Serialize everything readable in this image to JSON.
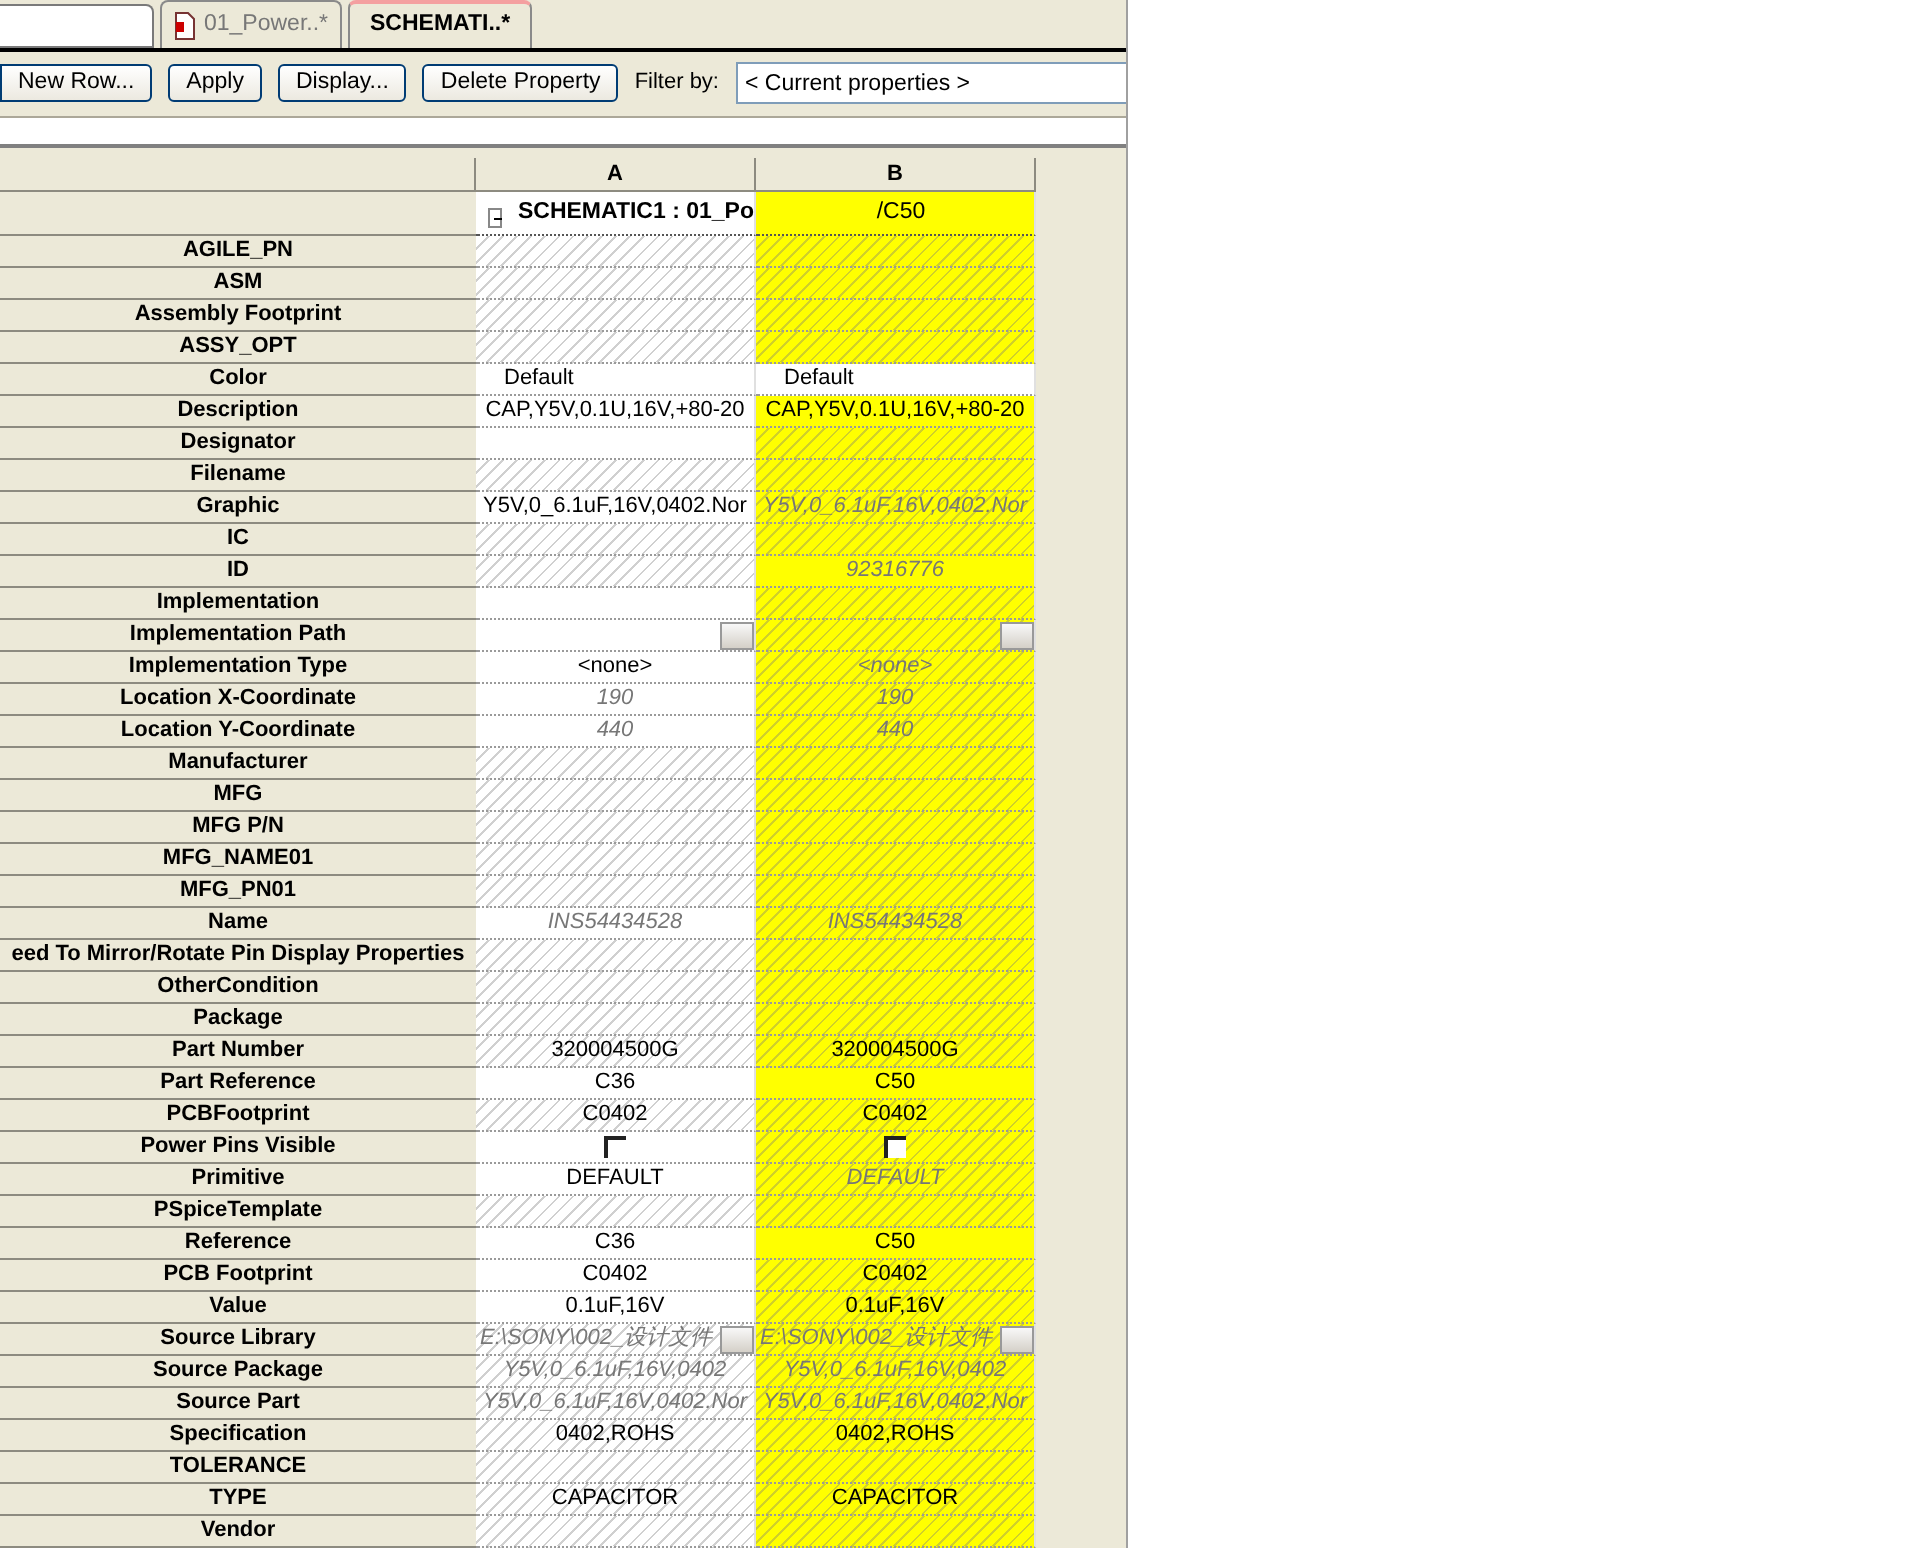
{
  "tabs": [
    {
      "label": "01_Power..*",
      "selected": false,
      "kind": "document"
    },
    {
      "label": "SCHEMATI..*",
      "selected": true,
      "kind": "plain"
    }
  ],
  "toolbar": {
    "buttons": [
      "New Row...",
      "Apply",
      "Display...",
      "Delete Property"
    ],
    "filter_label": "Filter by:",
    "filter_value": "< Current properties >"
  },
  "columns": [
    {
      "label": "A",
      "selected": false
    },
    {
      "label": "B",
      "selected": true
    }
  ],
  "group": {
    "expanded": true,
    "cells": [
      "SCHEMATIC1 : 01_Po",
      "/C50"
    ]
  },
  "rows": [
    {
      "name": "AGILE_PN",
      "cells": [
        {
          "hatched": true
        },
        {
          "hatched": true
        }
      ]
    },
    {
      "name": "ASM",
      "cells": [
        {
          "hatched": true
        },
        {
          "hatched": true
        }
      ]
    },
    {
      "name": "Assembly Footprint",
      "cells": [
        {
          "hatched": true
        },
        {
          "hatched": true
        }
      ]
    },
    {
      "name": "ASSY_OPT",
      "cells": [
        {
          "hatched": true
        },
        {
          "hatched": true
        }
      ]
    },
    {
      "name": "Color",
      "cells": [
        {
          "kind": "dropdown",
          "value": "Default"
        },
        {
          "kind": "dropdown",
          "value": "Default"
        }
      ]
    },
    {
      "name": "Description",
      "cells": [
        {
          "value": "CAP,Y5V,0.1U,16V,+80-20"
        },
        {
          "value": "CAP,Y5V,0.1U,16V,+80-20"
        }
      ]
    },
    {
      "name": "Designator",
      "cells": [
        {},
        {
          "hatched": true
        }
      ]
    },
    {
      "name": "Filename",
      "cells": [
        {
          "hatched": true
        },
        {
          "hatched": true
        }
      ]
    },
    {
      "name": "Graphic",
      "cells": [
        {
          "value": "Y5V,0_6.1uF,16V,0402.Nor"
        },
        {
          "value": "Y5V,0_6.1uF,16V,0402.Nor",
          "inherited": true,
          "hatched": true
        }
      ]
    },
    {
      "name": "IC",
      "cells": [
        {
          "hatched": true
        },
        {
          "hatched": true
        }
      ]
    },
    {
      "name": "ID",
      "cells": [
        {
          "hatched": true
        },
        {
          "value": "92316776",
          "inherited": true
        }
      ]
    },
    {
      "name": "Implementation",
      "cells": [
        {},
        {
          "hatched": true
        }
      ]
    },
    {
      "name": "Implementation Path",
      "cells": [
        {
          "kind": "browse"
        },
        {
          "kind": "browse",
          "hatched": true
        }
      ]
    },
    {
      "name": "Implementation Type",
      "cells": [
        {
          "value": "<none>"
        },
        {
          "value": "<none>",
          "inherited": true,
          "hatched": true
        }
      ]
    },
    {
      "name": "Location X-Coordinate",
      "cells": [
        {
          "value": "190",
          "inherited": true
        },
        {
          "value": "190",
          "inherited": true,
          "hatched": true
        }
      ]
    },
    {
      "name": "Location Y-Coordinate",
      "cells": [
        {
          "value": "440",
          "inherited": true
        },
        {
          "value": "440",
          "inherited": true,
          "hatched": true
        }
      ]
    },
    {
      "name": "Manufacturer",
      "cells": [
        {
          "hatched": true
        },
        {
          "hatched": true
        }
      ]
    },
    {
      "name": "MFG",
      "cells": [
        {
          "hatched": true
        },
        {
          "hatched": true
        }
      ]
    },
    {
      "name": "MFG P/N",
      "cells": [
        {
          "hatched": true
        },
        {
          "hatched": true
        }
      ]
    },
    {
      "name": "MFG_NAME01",
      "cells": [
        {
          "hatched": true
        },
        {
          "hatched": true
        }
      ]
    },
    {
      "name": "MFG_PN01",
      "cells": [
        {
          "hatched": true
        },
        {
          "hatched": true
        }
      ]
    },
    {
      "name": "Name",
      "cells": [
        {
          "value": "INS54434528",
          "inherited": true
        },
        {
          "value": "INS54434528",
          "inherited": true,
          "hatched": true
        }
      ]
    },
    {
      "name": "eed To Mirror/Rotate Pin Display Properties",
      "cells": [
        {
          "hatched": true
        },
        {
          "hatched": true
        }
      ]
    },
    {
      "name": "OtherCondition",
      "cells": [
        {
          "hatched": true
        },
        {
          "hatched": true
        }
      ]
    },
    {
      "name": "Package",
      "cells": [
        {
          "hatched": true
        },
        {
          "hatched": true
        }
      ]
    },
    {
      "name": "Part Number",
      "cells": [
        {
          "value": "320004500G",
          "hatched": true
        },
        {
          "value": "320004500G",
          "hatched": true
        }
      ]
    },
    {
      "name": "Part Reference",
      "cells": [
        {
          "value": "C36"
        },
        {
          "value": "C50"
        }
      ]
    },
    {
      "name": "PCBFootprint",
      "cells": [
        {
          "value": "C0402",
          "hatched": true
        },
        {
          "value": "C0402",
          "hatched": true
        }
      ]
    },
    {
      "name": "Power Pins Visible",
      "cells": [
        {
          "kind": "checkbox",
          "checked": false
        },
        {
          "kind": "checkbox",
          "checked": false,
          "hatched": true
        }
      ]
    },
    {
      "name": "Primitive",
      "cells": [
        {
          "value": "DEFAULT"
        },
        {
          "value": "DEFAULT",
          "inherited": true,
          "hatched": true
        }
      ]
    },
    {
      "name": "PSpiceTemplate",
      "cells": [
        {
          "hatched": true
        },
        {
          "hatched": true
        }
      ]
    },
    {
      "name": "Reference",
      "cells": [
        {
          "value": "C36"
        },
        {
          "value": "C50"
        }
      ]
    },
    {
      "name": "PCB Footprint",
      "cells": [
        {
          "value": "C0402"
        },
        {
          "value": "C0402",
          "hatched": true
        }
      ]
    },
    {
      "name": "Value",
      "cells": [
        {
          "value": "0.1uF,16V"
        },
        {
          "value": "0.1uF,16V",
          "hatched": true
        }
      ]
    },
    {
      "name": "Source Library",
      "cells": [
        {
          "kind": "browse",
          "value": "E:\\SONY\\002_设计文件",
          "inherited": true,
          "hatched": true
        },
        {
          "kind": "browse",
          "value": "E:\\SONY\\002_设计文件",
          "inherited": true,
          "hatched": true
        }
      ]
    },
    {
      "name": "Source Package",
      "cells": [
        {
          "value": "Y5V,0_6.1uF,16V,0402",
          "inherited": true,
          "hatched": true
        },
        {
          "value": "Y5V,0_6.1uF,16V,0402",
          "inherited": true,
          "hatched": true
        }
      ]
    },
    {
      "name": "Source Part",
      "cells": [
        {
          "value": "Y5V,0_6.1uF,16V,0402.Nor",
          "inherited": true,
          "hatched": true
        },
        {
          "value": "Y5V,0_6.1uF,16V,0402.Nor",
          "inherited": true,
          "hatched": true
        }
      ]
    },
    {
      "name": "Specification",
      "cells": [
        {
          "value": "0402,ROHS",
          "hatched": true
        },
        {
          "value": "0402,ROHS",
          "hatched": true
        }
      ]
    },
    {
      "name": "TOLERANCE",
      "cells": [
        {
          "hatched": true
        },
        {
          "hatched": true
        }
      ]
    },
    {
      "name": "TYPE",
      "cells": [
        {
          "value": "CAPACITOR",
          "hatched": true
        },
        {
          "value": "CAPACITOR",
          "hatched": true
        }
      ]
    },
    {
      "name": "Vendor",
      "cells": [
        {
          "hatched": true
        },
        {
          "hatched": true
        }
      ]
    }
  ]
}
